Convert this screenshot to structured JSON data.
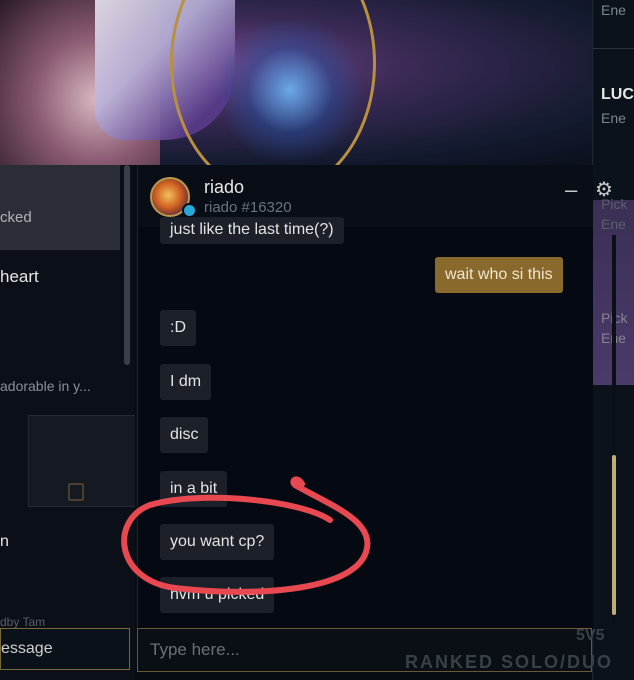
{
  "right_col": {
    "top_text": "Ene",
    "name": "LUC",
    "second_text": "Ene",
    "pick_1": "Pick",
    "pick_1_sub": "Ene",
    "pick_2": "Pick",
    "pick_2_sub": "Ene"
  },
  "left_col": {
    "item_1": "cked",
    "item_2": "heart",
    "item_3": "adorable in y...",
    "item_4": "n",
    "item_5": "dby Tam",
    "message_button": "essage"
  },
  "chat": {
    "name": "riado",
    "tag": "riado #16320",
    "minimize": "–",
    "messages": [
      {
        "text": "just like the last time(?)",
        "from": "other"
      },
      {
        "text": "wait who si this",
        "from": "self"
      },
      {
        "text": ":D",
        "from": "other"
      },
      {
        "text": "I dm",
        "from": "other"
      },
      {
        "text": "disc",
        "from": "other"
      },
      {
        "text": "in a bit",
        "from": "other"
      },
      {
        "text": "you want cp?",
        "from": "other"
      },
      {
        "text": "nvm u picked",
        "from": "other"
      }
    ],
    "input_placeholder": "Type here...",
    "status_color": "#2aa8d8",
    "self_bubble_color": "#8a6a2c"
  },
  "footer": {
    "ranked": "RANKED SOLO/DUO",
    "mode": "5V5"
  },
  "annotation_color": "#e84850"
}
